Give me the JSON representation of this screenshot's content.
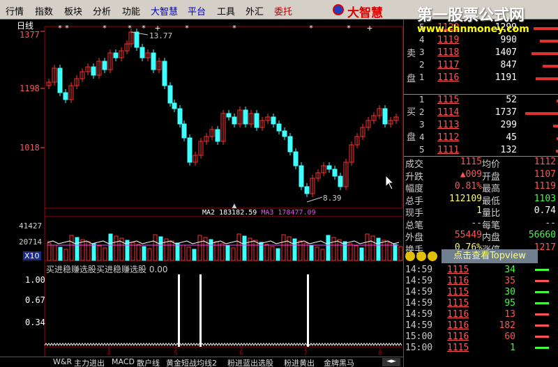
{
  "menu": [
    "行情",
    "指数",
    "板块",
    "分析",
    "功能",
    "大智慧",
    "平台",
    "工具",
    "外汇",
    "委托"
  ],
  "menu_colors": [
    "#000000",
    "#000000",
    "#000000",
    "#000000",
    "#000000",
    "#0000c0",
    "#0000c0",
    "#000000",
    "#000000",
    "#c00000"
  ],
  "logo_text": "大智慧",
  "watermark": {
    "title": "第一股票公式网",
    "url": "www.chnmoney.com"
  },
  "chart": {
    "period": "日线",
    "price_ticks": [
      "1377",
      "1198",
      "1018"
    ],
    "high_label": "13.77",
    "low_label": "8.39",
    "volume_ticks": [
      "41427",
      "20714"
    ],
    "volume_unit": "X10",
    "ma_legend": [
      {
        "label": "MA2",
        "value": "183182.59",
        "color": "#ffffff"
      },
      {
        "label": "MA3",
        "value": "178477.09",
        "color": "#ff40ff"
      }
    ],
    "indicator_title": "买进稳赚选股买进稳赚选股 0.00",
    "indicator_ticks": [
      "1.00",
      "0.67",
      "0.34"
    ],
    "x_ticks": [
      "4",
      "5",
      "6",
      "7",
      "8"
    ]
  },
  "tabs": [
    "W&R",
    "主力进出",
    "MACD",
    "散户线",
    "黄金短战均线2",
    "粉进蓝出选股",
    "粉进黄出",
    "金牌黑马"
  ],
  "order_book": {
    "sell_label": [
      "卖",
      "盘"
    ],
    "buy_label": [
      "买",
      "盘"
    ],
    "asks": [
      {
        "n": "5",
        "price": "1120",
        "vol": "1299"
      },
      {
        "n": "4",
        "price": "1119",
        "vol": "990"
      },
      {
        "n": "3",
        "price": "1118",
        "vol": "1407"
      },
      {
        "n": "2",
        "price": "1117",
        "vol": "847"
      },
      {
        "n": "1",
        "price": "1116",
        "vol": "1191"
      }
    ],
    "bids": [
      {
        "n": "1",
        "price": "1115",
        "vol": "52"
      },
      {
        "n": "2",
        "price": "1114",
        "vol": "1737"
      },
      {
        "n": "3",
        "price": "1113",
        "vol": "299"
      },
      {
        "n": "4",
        "price": "1112",
        "vol": "45"
      },
      {
        "n": "5",
        "price": "1111",
        "vol": "132"
      }
    ]
  },
  "stats": [
    {
      "l1": "成交",
      "v1": "1115",
      "c1": "#ff5555",
      "l2": "均价",
      "v2": "1112",
      "c2": "#ff5555"
    },
    {
      "l1": "升跌",
      "v1": "▲009",
      "c1": "#ff5555",
      "l2": "开盘",
      "v2": "1107",
      "c2": "#ff5555"
    },
    {
      "l1": "幅度",
      "v1": "0.81%",
      "c1": "#ff5555",
      "l2": "最高",
      "v2": "1119",
      "c2": "#ff5555"
    },
    {
      "l1": "总手",
      "v1": "112109",
      "c1": "#ffff60",
      "l2": "最低",
      "v2": "1103",
      "c2": "#40ff40"
    },
    {
      "l1": "现手",
      "v1": "1",
      "c1": "#ffff60",
      "l2": "量比",
      "v2": "0.74",
      "c2": "#ffffff"
    },
    {
      "l1": "总笔",
      "v1": "--",
      "c1": "#ccc",
      "l2": "每笔",
      "v2": "--",
      "c2": "#ccc"
    },
    {
      "l1": "外盘",
      "v1": "55449",
      "c1": "#ff5555",
      "l2": "内盘",
      "v2": "56660",
      "c2": "#40ff40"
    },
    {
      "l1": "换手",
      "v1": "0.76%",
      "c1": "#ffff60",
      "l2": "涨停",
      "v2": "1217",
      "c2": "#ff5555"
    }
  ],
  "topview_label": "点击查看Topview",
  "ticks": [
    {
      "t": "14:59",
      "p": "1115",
      "v": "34",
      "c": "#40ff40"
    },
    {
      "t": "14:59",
      "p": "1116",
      "v": "35",
      "c": "#ff5555"
    },
    {
      "t": "14:59",
      "p": "1115",
      "v": "30",
      "c": "#40ff40"
    },
    {
      "t": "14:59",
      "p": "1115",
      "v": "95",
      "c": "#40ff40"
    },
    {
      "t": "14:59",
      "p": "1116",
      "v": "13",
      "c": "#ff5555"
    },
    {
      "t": "14:59",
      "p": "1116",
      "v": "182",
      "c": "#ff5555"
    },
    {
      "t": "15:00",
      "p": "1116",
      "v": "60",
      "c": "#ff5555"
    },
    {
      "t": "15:00",
      "p": "1115",
      "v": "1",
      "c": "#40ff40"
    }
  ],
  "colors": {
    "up": "#ff3030",
    "down": "#40ffff",
    "signal": "#ffffff"
  }
}
